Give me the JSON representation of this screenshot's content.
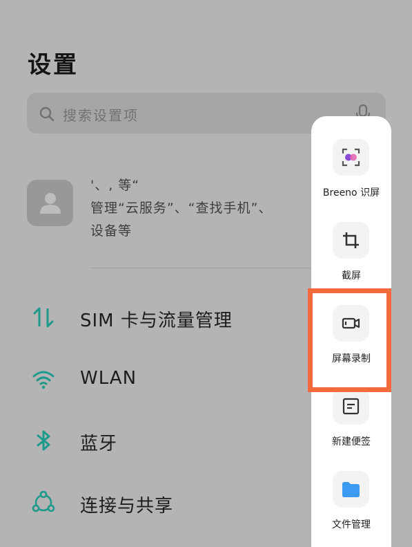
{
  "page": {
    "title": "设置"
  },
  "search": {
    "placeholder": "搜索设置项"
  },
  "account": {
    "line1": "'、, 等“",
    "line2": "管理“云服务”、“查找手机”、",
    "line3": "设备等"
  },
  "settings": [
    {
      "label": "SIM 卡与流量管理",
      "icon": "sim-data-icon"
    },
    {
      "label": "WLAN",
      "icon": "wifi-icon"
    },
    {
      "label": "蓝牙",
      "icon": "bluetooth-icon"
    },
    {
      "label": "连接与共享",
      "icon": "connection-share-icon"
    }
  ],
  "sidebar_tools": [
    {
      "label": "Breeno 识屏",
      "icon": "breeno-icon"
    },
    {
      "label": "截屏",
      "icon": "crop-icon"
    },
    {
      "label": "屏幕录制",
      "icon": "screen-record-icon"
    },
    {
      "label": "新建便签",
      "icon": "note-icon"
    },
    {
      "label": "文件管理",
      "icon": "folder-icon"
    }
  ],
  "colors": {
    "accent": "#1e9a8c",
    "highlight": "#f36b3c",
    "folder": "#3b9bf2"
  }
}
